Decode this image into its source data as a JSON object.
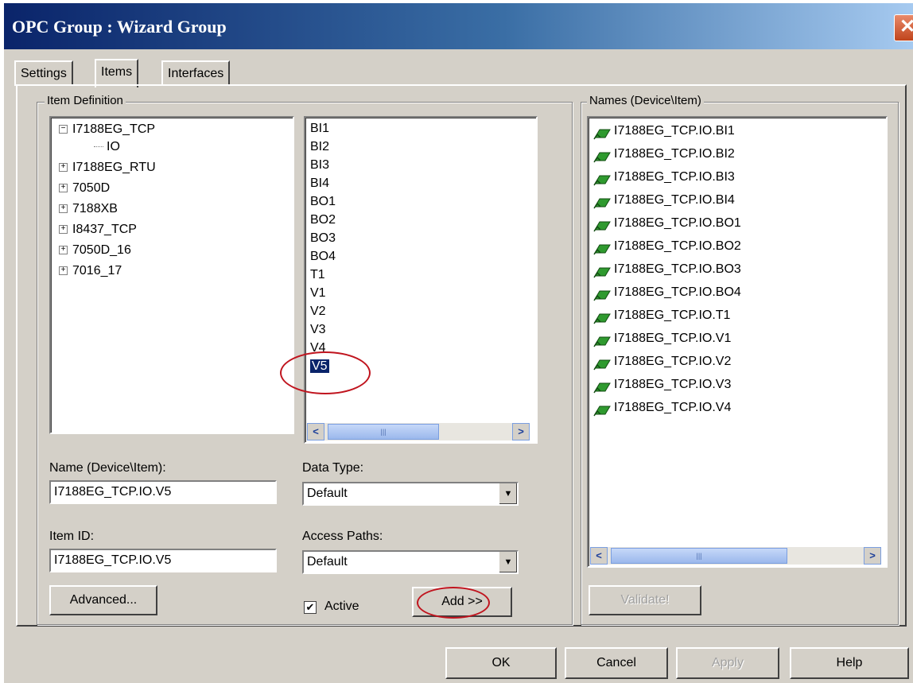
{
  "window": {
    "title": "OPC Group : Wizard Group",
    "close_glyph": "✕"
  },
  "tabs": [
    {
      "label": "Settings",
      "active": false
    },
    {
      "label": "Items",
      "active": true
    },
    {
      "label": "Interfaces",
      "active": false
    }
  ],
  "item_definition": {
    "legend": "Item Definition",
    "tree": [
      {
        "label": "I7188EG_TCP",
        "expander": "−"
      },
      {
        "label": "IO",
        "expander": ""
      },
      {
        "label": "I7188EG_RTU",
        "expander": "+"
      },
      {
        "label": "7050D",
        "expander": "+"
      },
      {
        "label": "7188XB",
        "expander": "+"
      },
      {
        "label": "I8437_TCP",
        "expander": "+"
      },
      {
        "label": "7050D_16",
        "expander": "+"
      },
      {
        "label": "7016_17",
        "expander": "+"
      }
    ],
    "items": [
      "BI1",
      "BI2",
      "BI3",
      "BI4",
      "BO1",
      "BO2",
      "BO3",
      "BO4",
      "T1",
      "V1",
      "V2",
      "V3",
      "V4",
      "V5"
    ],
    "selected_item": "V5",
    "scroll_left": "<",
    "scroll_right": ">",
    "scroll_grip": "|||",
    "name_label": "Name (Device\\Item):",
    "name_value": "I7188EG_TCP.IO.V5",
    "item_id_label": "Item ID:",
    "item_id_value": "I7188EG_TCP.IO.V5",
    "data_type_label": "Data Type:",
    "data_type_value": "Default",
    "access_paths_label": "Access Paths:",
    "access_paths_value": "Default",
    "combo_arrow": "▼",
    "advanced_label": "Advanced...",
    "active_label": "Active",
    "active_checked": true,
    "check_glyph": "✔",
    "add_label": "Add >>"
  },
  "names": {
    "legend": "Names (Device\\Item)",
    "items": [
      "I7188EG_TCP.IO.BI1",
      "I7188EG_TCP.IO.BI2",
      "I7188EG_TCP.IO.BI3",
      "I7188EG_TCP.IO.BI4",
      "I7188EG_TCP.IO.BO1",
      "I7188EG_TCP.IO.BO2",
      "I7188EG_TCP.IO.BO3",
      "I7188EG_TCP.IO.BO4",
      "I7188EG_TCP.IO.T1",
      "I7188EG_TCP.IO.V1",
      "I7188EG_TCP.IO.V2",
      "I7188EG_TCP.IO.V3",
      "I7188EG_TCP.IO.V4"
    ],
    "item_icon": "tag-icon",
    "validate_label": "Validate!"
  },
  "footer": {
    "ok": "OK",
    "cancel": "Cancel",
    "apply": "Apply",
    "help": "Help"
  },
  "colors": {
    "highlight": "#0a246a",
    "annotation": "#c0141e",
    "tag_green": "#2f9a2f"
  }
}
